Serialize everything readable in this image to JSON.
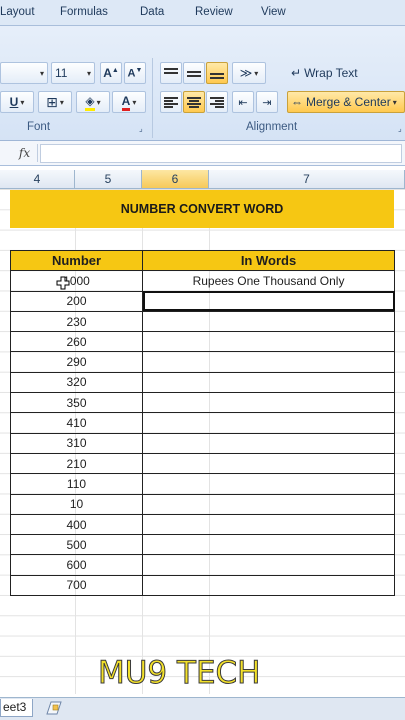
{
  "ribbon": {
    "tabs": [
      "Layout",
      "Formulas",
      "Data",
      "Review",
      "View"
    ],
    "font_size": "11",
    "wrap_text": "Wrap Text",
    "merge_center": "Merge & Center",
    "groups": {
      "font": "Font",
      "alignment": "Alignment"
    }
  },
  "formula_bar": {
    "fx": "fx",
    "value": ""
  },
  "columns": [
    "4",
    "5",
    "6",
    "7"
  ],
  "sheet": {
    "title": "NUMBER CONVERT WORD",
    "headers": {
      "number": "Number",
      "in_words": "In Words"
    },
    "rows": [
      {
        "number": "1000",
        "words": "Rupees One Thousand  Only"
      },
      {
        "number": "200",
        "words": ""
      },
      {
        "number": "230",
        "words": ""
      },
      {
        "number": "260",
        "words": ""
      },
      {
        "number": "290",
        "words": ""
      },
      {
        "number": "320",
        "words": ""
      },
      {
        "number": "350",
        "words": ""
      },
      {
        "number": "410",
        "words": ""
      },
      {
        "number": "310",
        "words": ""
      },
      {
        "number": "210",
        "words": ""
      },
      {
        "number": "110",
        "words": ""
      },
      {
        "number": "10",
        "words": ""
      },
      {
        "number": "400",
        "words": ""
      },
      {
        "number": "500",
        "words": ""
      },
      {
        "number": "600",
        "words": ""
      },
      {
        "number": "700",
        "words": ""
      }
    ]
  },
  "watermark": "MU9 TECH",
  "sheet_tabs": {
    "current": "eet3"
  },
  "colors": {
    "header_yellow": "#f6c713",
    "ribbon_blue": "#d5e3f5"
  }
}
